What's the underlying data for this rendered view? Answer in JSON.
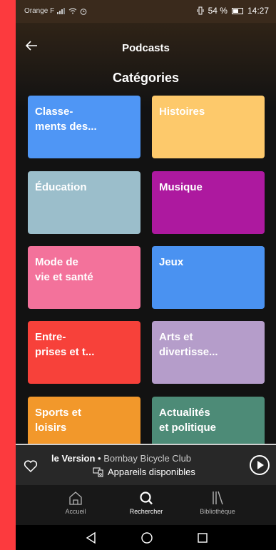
{
  "status": {
    "carrier": "Orange F",
    "battery_text": "54 %",
    "time": "14:27"
  },
  "header": {
    "title": "Podcasts",
    "section": "Catégories"
  },
  "categories": [
    {
      "label": "Classe-\nments des...",
      "color": "#4f96f5"
    },
    {
      "label": "Histoires",
      "color": "#fdc96b"
    },
    {
      "label": "Éducation",
      "color": "#9bbecb"
    },
    {
      "label": "Musique",
      "color": "#ad199f"
    },
    {
      "label": "Mode de\nvie et santé",
      "color": "#f3729b"
    },
    {
      "label": "Jeux",
      "color": "#4a92f1"
    },
    {
      "label": "Entre-\nprises et t...",
      "color": "#f7413a"
    },
    {
      "label": "Arts et\ndivertisse...",
      "color": "#b59dca"
    },
    {
      "label": "Sports et\nloisirs",
      "color": "#f2982b"
    },
    {
      "label": "Actualités\net politique",
      "color": "#4d8b77"
    }
  ],
  "now_playing": {
    "title": "le Version",
    "separator": " • ",
    "artist": "Bombay Bicycle Club",
    "device_text": "Appareils disponibles"
  },
  "nav": {
    "home": "Accueil",
    "search": "Rechercher",
    "library": "Bibliothèque"
  }
}
